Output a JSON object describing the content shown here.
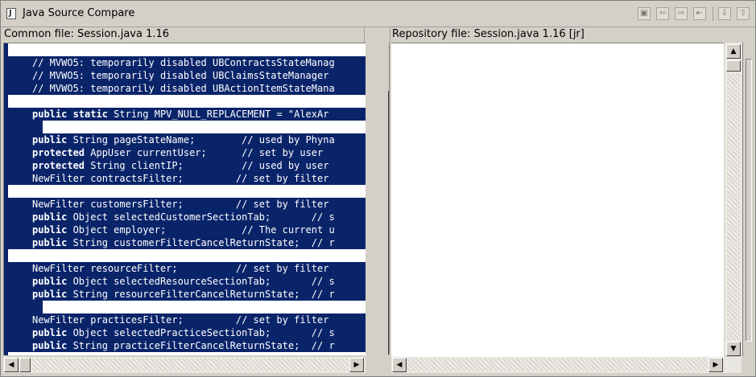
{
  "window": {
    "title": "Java Source Compare",
    "title_icon": "java-file-icon"
  },
  "toolbar": {
    "buttons": [
      {
        "name": "copy-all-left-button",
        "icon": "copy-all-icon",
        "glyph": "▣"
      },
      {
        "name": "copy-left-button",
        "icon": "copy-left-icon",
        "glyph": "⇦"
      },
      {
        "name": "copy-right-button",
        "icon": "copy-right-icon",
        "glyph": "⇨"
      },
      {
        "name": "copy-all-right-button",
        "icon": "copy-all-right-icon",
        "glyph": "⇤"
      },
      {
        "name": "next-difference-button",
        "icon": "arrow-down-icon",
        "glyph": "⇩"
      },
      {
        "name": "previous-difference-button",
        "icon": "arrow-up-icon",
        "glyph": "⇧"
      }
    ]
  },
  "left_pane": {
    "header": "Common file: Session.java 1.16"
  },
  "right_pane": {
    "header": "Repository file: Session.java 1.16 [jr]"
  },
  "code_lines": [
    {
      "type": "blank"
    },
    {
      "type": "code",
      "kw": "",
      "rest": "// MVWO5: temporarily disabled UBContractsStateManag"
    },
    {
      "type": "code",
      "kw": "",
      "rest": "// MVWO5: temporarily disabled UBClaimsStateManager "
    },
    {
      "type": "code",
      "kw": "",
      "rest": "// MVWO5: temporarily disabled UBActionItemStateMana"
    },
    {
      "type": "blank"
    },
    {
      "type": "code",
      "kw": "public static",
      "rest": " String MPV_NULL_REPLACEMENT = \"AlexAr"
    },
    {
      "type": "inner"
    },
    {
      "type": "code",
      "kw": "public",
      "rest": " String pageStateName;        // used by Phyna"
    },
    {
      "type": "code",
      "kw": "protected",
      "rest": " AppUser currentUser;      // set by user "
    },
    {
      "type": "code",
      "kw": "protected",
      "rest": " String clientIP;          // used by user "
    },
    {
      "type": "code",
      "kw": "",
      "rest": "NewFilter contractsFilter;         // set by filter"
    },
    {
      "type": "blank"
    },
    {
      "type": "code",
      "kw": "",
      "rest": "NewFilter customersFilter;         // set by filter"
    },
    {
      "type": "code",
      "kw": "public",
      "rest": " Object selectedCustomerSectionTab;       // s"
    },
    {
      "type": "code",
      "kw": "public",
      "rest": " Object employer;             // The current u"
    },
    {
      "type": "code",
      "kw": "public",
      "rest": " String customerFilterCancelReturnState;  // r"
    },
    {
      "type": "blank"
    },
    {
      "type": "code",
      "kw": "",
      "rest": "NewFilter resourceFilter;          // set by filter"
    },
    {
      "type": "code",
      "kw": "public",
      "rest": " Object selectedResourceSectionTab;       // s"
    },
    {
      "type": "code",
      "kw": "public",
      "rest": " String resourceFilterCancelReturnState;  // r"
    },
    {
      "type": "inner"
    },
    {
      "type": "code",
      "kw": "",
      "rest": "NewFilter practicesFilter;         // set by filter"
    },
    {
      "type": "code",
      "kw": "public",
      "rest": " Object selectedPracticeSectionTab;       // s"
    },
    {
      "type": "code",
      "kw": "public",
      "rest": " String practiceFilterCancelReturnState;  // r"
    }
  ],
  "colors": {
    "selection_bg": "#0a246a",
    "selection_fg": "#ffffff",
    "chrome": "#d4d0c8"
  }
}
